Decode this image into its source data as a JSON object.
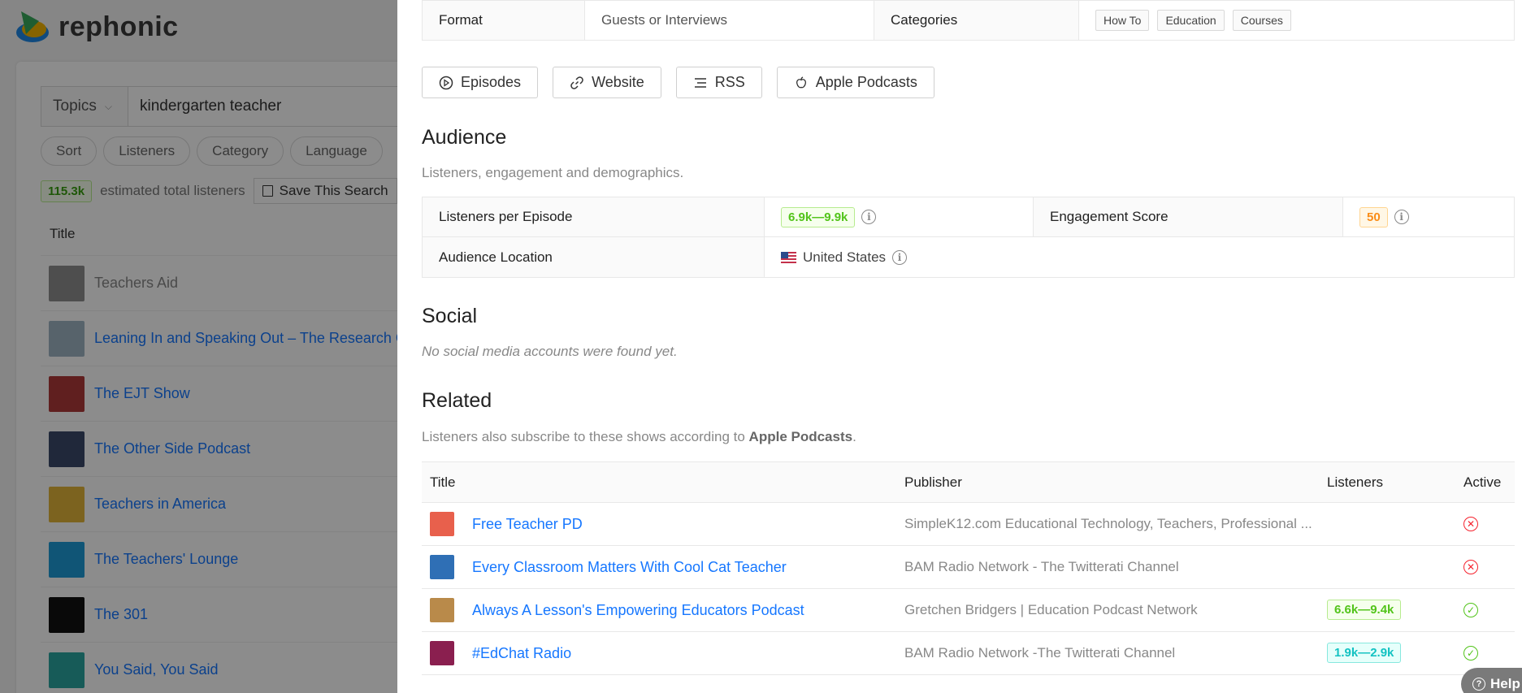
{
  "app": {
    "name": "rephonic"
  },
  "background": {
    "topics_label": "Topics",
    "search_value": "kindergarten teacher",
    "filters": [
      "Sort",
      "Listeners",
      "Category",
      "Language"
    ],
    "total_listeners": "115.3k",
    "total_listeners_text": "estimated total listeners",
    "save_search": "Save This Search",
    "title_col": "Title",
    "list": [
      {
        "name": "Teachers Aid",
        "color": "#8e8e8e"
      },
      {
        "name": "Leaning In and Speaking Out – The Research Co",
        "color": "#9fb4c4"
      },
      {
        "name": "The EJT Show",
        "color": "#b03a3a"
      },
      {
        "name": "The Other Side Podcast",
        "color": "#3b4a6b"
      },
      {
        "name": "Teachers in America",
        "color": "#e2b53a"
      },
      {
        "name": "The Teachers' Lounge",
        "color": "#1e9bd7"
      },
      {
        "name": "The 301",
        "color": "#111111"
      },
      {
        "name": "You Said, You Said",
        "color": "#2aa7a0"
      }
    ]
  },
  "details": {
    "format_label": "Format",
    "format_value": "Guests or Interviews",
    "categories_label": "Categories",
    "categories": [
      "How To",
      "Education",
      "Courses"
    ]
  },
  "buttons": {
    "episodes": "Episodes",
    "website": "Website",
    "rss": "RSS",
    "apple": "Apple Podcasts"
  },
  "audience": {
    "title": "Audience",
    "subtitle": "Listeners, engagement and demographics.",
    "listeners_label": "Listeners per Episode",
    "listeners_value": "6.9k—9.9k",
    "engagement_label": "Engagement Score",
    "engagement_value": "50",
    "location_label": "Audience Location",
    "location_value": "United States"
  },
  "social": {
    "title": "Social",
    "empty": "No social media accounts were found yet."
  },
  "related": {
    "title": "Related",
    "subtitle_pre": "Listeners also subscribe to these shows according to ",
    "subtitle_bold": "Apple Podcasts",
    "subtitle_post": ".",
    "headers": {
      "title": "Title",
      "publisher": "Publisher",
      "listeners": "Listeners",
      "active": "Active"
    },
    "rows": [
      {
        "title": "Free Teacher PD",
        "publisher": "SimpleK12.com Educational Technology, Teachers, Professional ...",
        "listeners": "",
        "active": false,
        "thumb": "#e8604c"
      },
      {
        "title": "Every Classroom Matters With Cool Cat Teacher",
        "publisher": "BAM Radio Network - The Twitterati Channel",
        "listeners": "",
        "active": false,
        "thumb": "#2f6fb5"
      },
      {
        "title": "Always A Lesson's Empowering Educators Podcast",
        "publisher": "Gretchen Bridgers | Education Podcast Network",
        "listeners": "6.6k—9.4k",
        "active": true,
        "thumb": "#b98a4a"
      },
      {
        "title": "#EdChat Radio",
        "publisher": "BAM Radio Network -The Twitterati Channel",
        "listeners": "1.9k—2.9k",
        "active": true,
        "thumb": "#8a1f4f"
      }
    ]
  },
  "help": {
    "label": "Help"
  }
}
